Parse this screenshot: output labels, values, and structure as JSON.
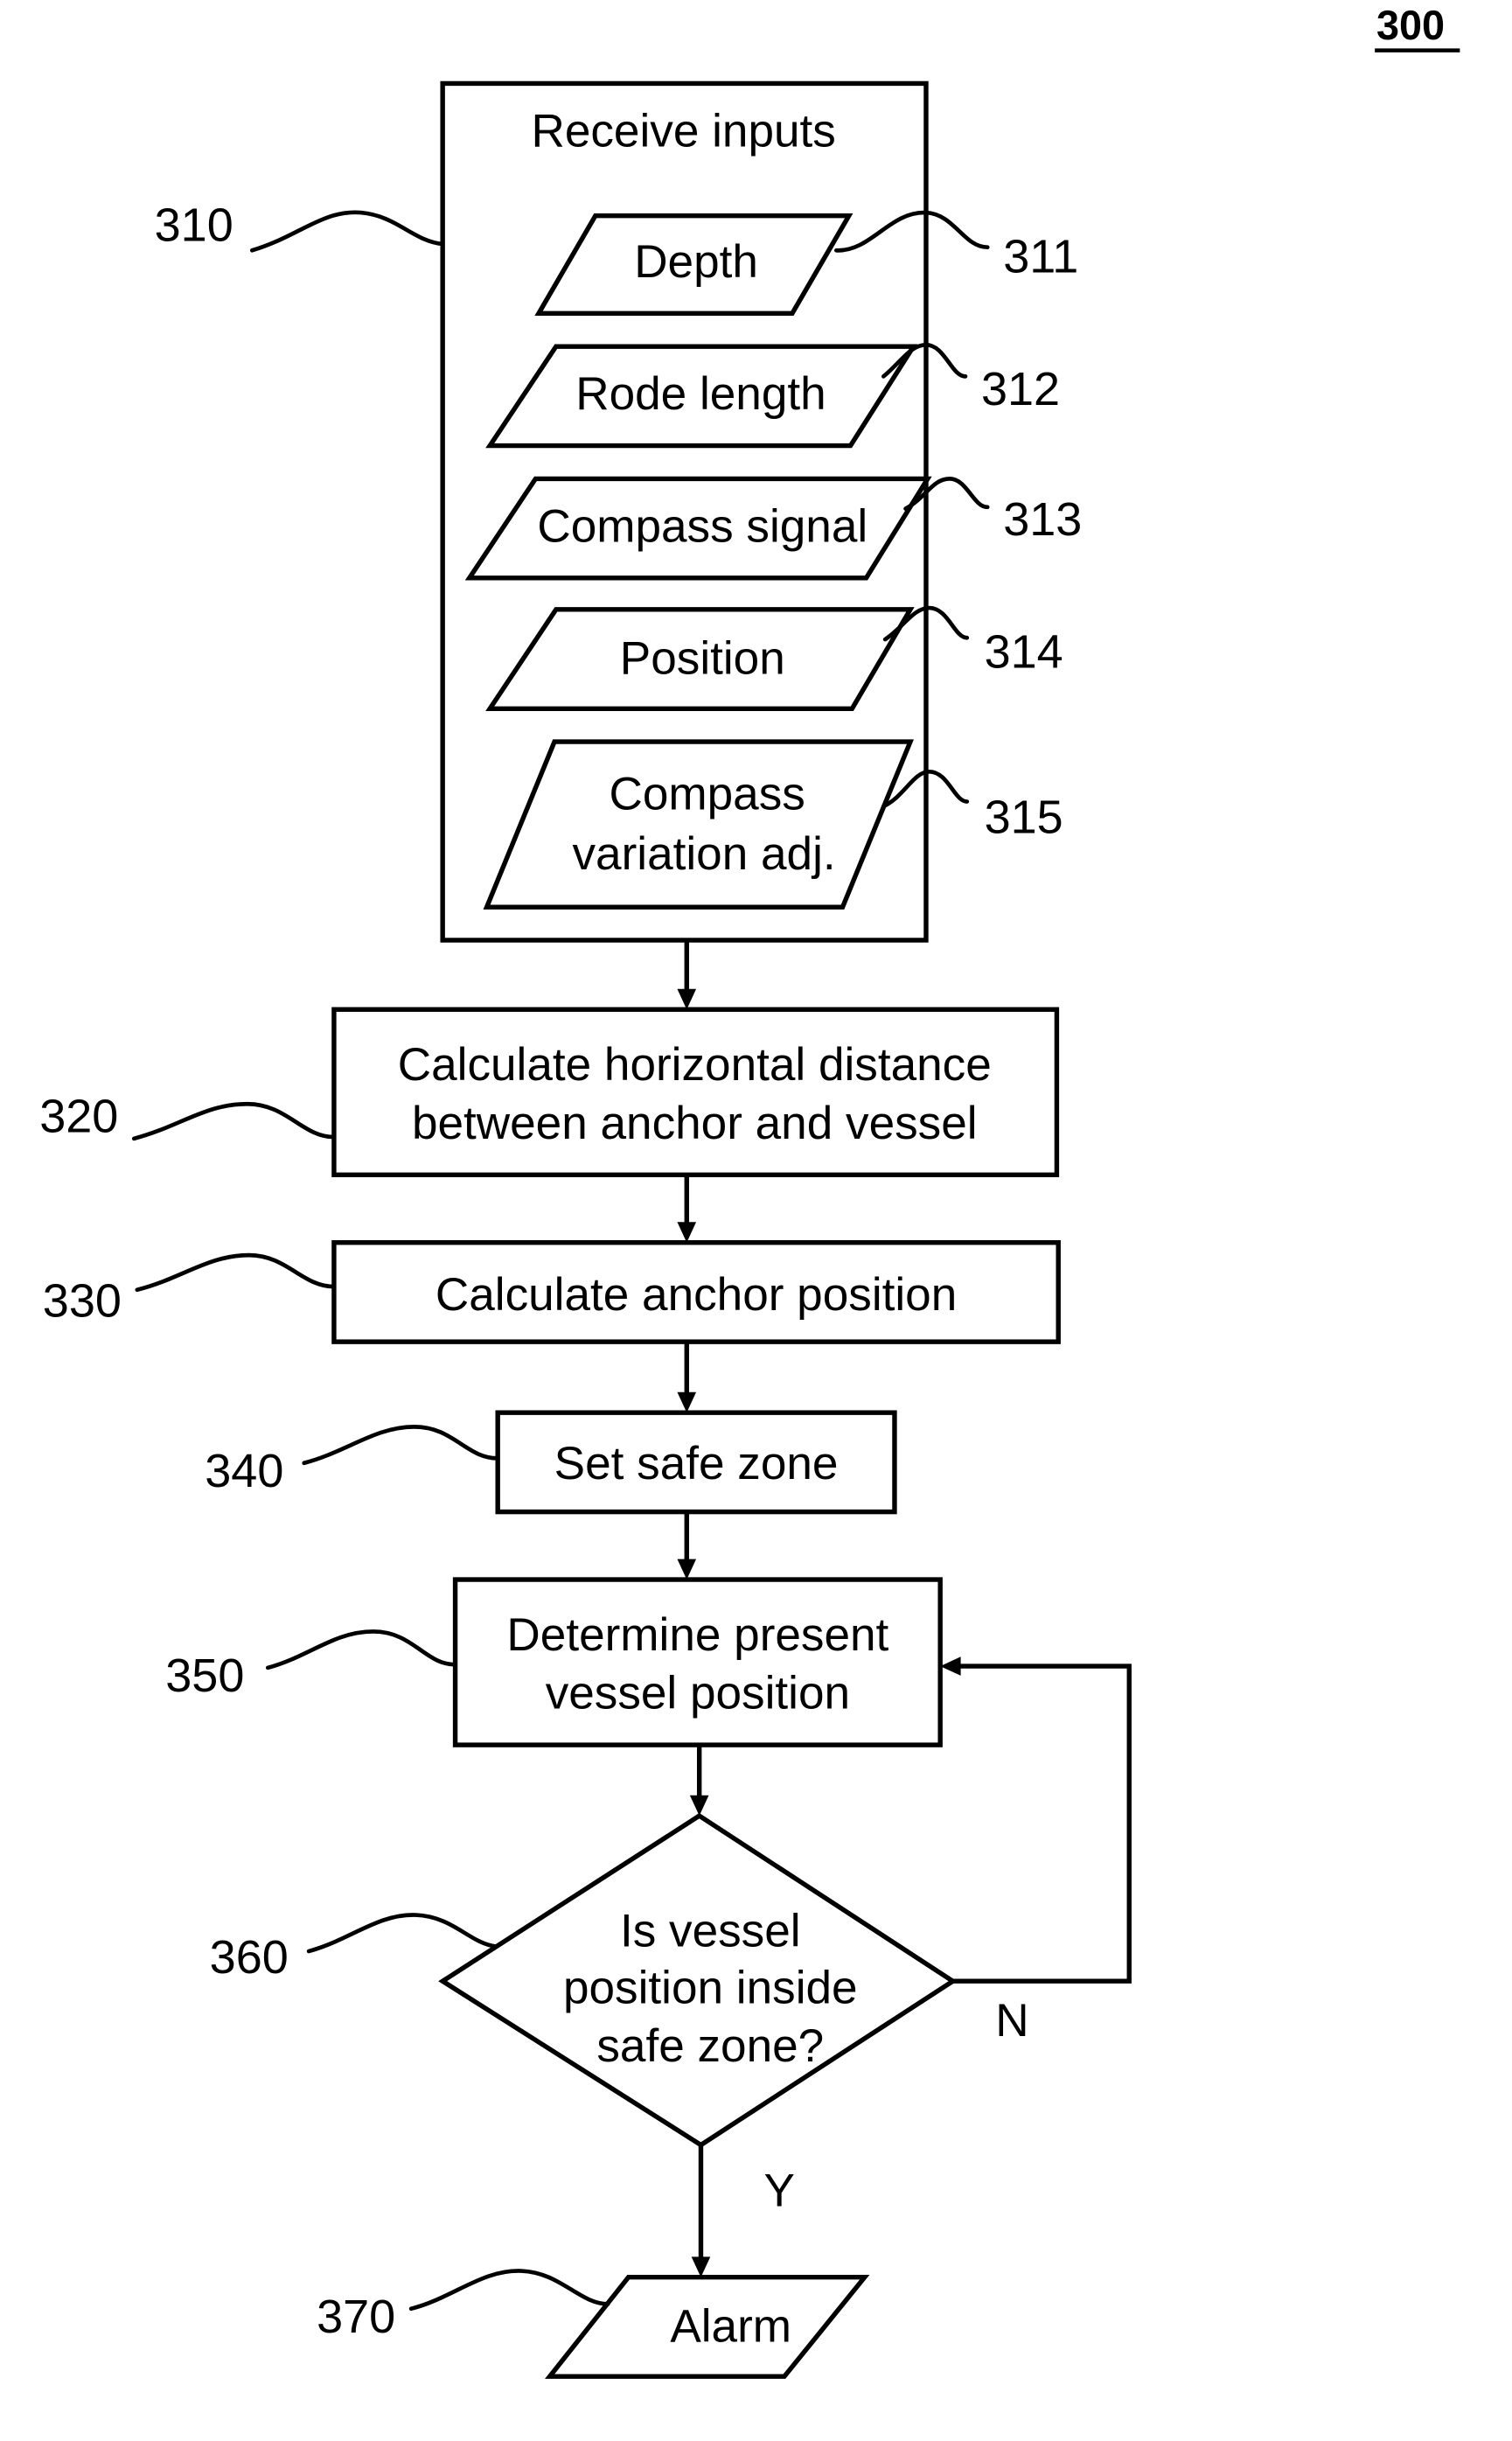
{
  "figure_number": "300",
  "receive_inputs": {
    "ref": "310",
    "title": "Receive inputs",
    "inputs": [
      {
        "ref": "311",
        "lines": [
          "Depth"
        ]
      },
      {
        "ref": "312",
        "lines": [
          "Rode length"
        ]
      },
      {
        "ref": "313",
        "lines": [
          "Compass signal"
        ]
      },
      {
        "ref": "314",
        "lines": [
          "Position"
        ]
      },
      {
        "ref": "315",
        "lines": [
          "Compass",
          "variation adj."
        ]
      }
    ]
  },
  "steps": [
    {
      "ref": "320",
      "lines": [
        "Calculate horizontal distance",
        "between anchor and vessel"
      ]
    },
    {
      "ref": "330",
      "lines": [
        "Calculate anchor position"
      ]
    },
    {
      "ref": "340",
      "lines": [
        "Set safe zone"
      ]
    },
    {
      "ref": "350",
      "lines": [
        "Determine present",
        "vessel position"
      ]
    }
  ],
  "decision": {
    "ref": "360",
    "lines": [
      "Is vessel",
      "position inside",
      "safe zone?"
    ],
    "no_label": "N",
    "yes_label": "Y"
  },
  "output": {
    "ref": "370",
    "lines": [
      "Alarm"
    ]
  },
  "colors": {
    "ink": "#000000",
    "paper": "#ffffff"
  }
}
